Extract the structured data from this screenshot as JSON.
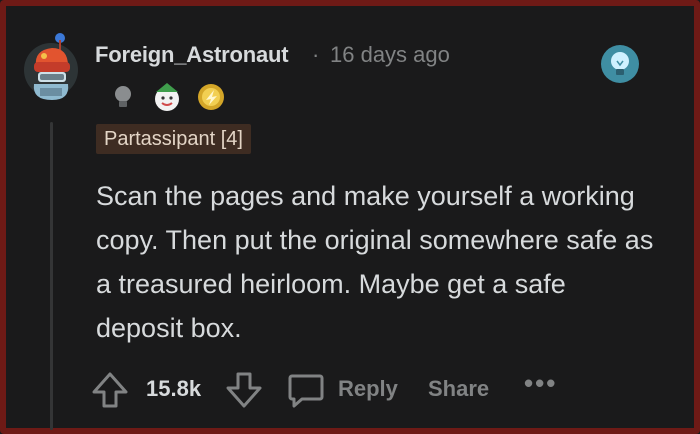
{
  "comment": {
    "username": "Foreign_Astronaut",
    "separator": "·",
    "timestamp": "16 days ago",
    "flair": "Partassipant [4]",
    "body": "Scan the pages and make yourself a working copy. Then put the original somewhere safe as a treasured heirloom. Maybe get a safe deposit box."
  },
  "awards": [
    {
      "icon": "lightbulb-award-icon"
    },
    {
      "icon": "wholesome-award-icon"
    },
    {
      "icon": "gold-award-icon"
    }
  ],
  "actions": {
    "score": "15.8k",
    "reply_label": "Reply",
    "share_label": "Share",
    "more_label": "•••"
  },
  "colors": {
    "background": "#1a1a1b",
    "border": "#6e1a16",
    "text": "#d7dadc",
    "muted": "#818384",
    "flair_bg": "#3e2c22"
  }
}
